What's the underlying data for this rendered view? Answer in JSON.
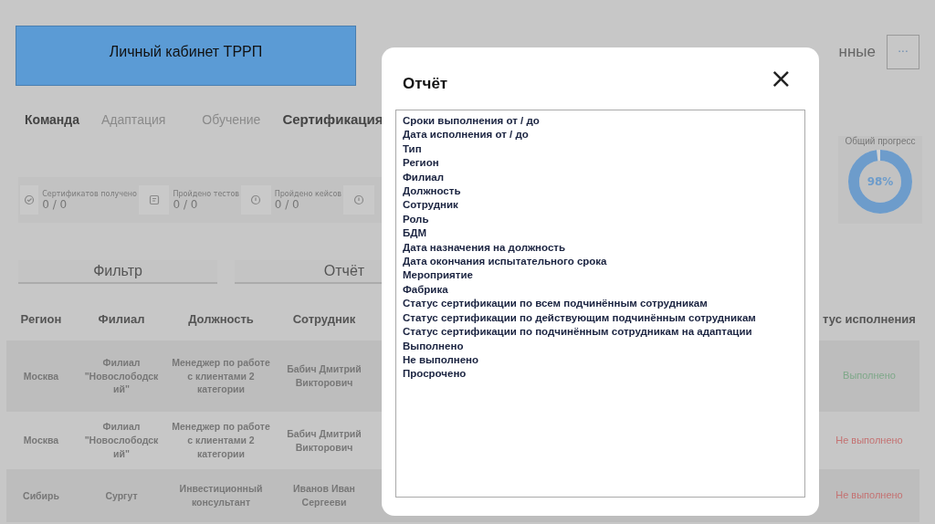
{
  "header": {
    "title": "Личный кабинет ТРРП",
    "right_text": "нные",
    "more_button": "···"
  },
  "tabs": [
    {
      "label": "Команда",
      "selected": true
    },
    {
      "label": "Адаптация",
      "selected": false
    },
    {
      "label": "Обучение",
      "selected": false
    },
    {
      "label": "Сертификация",
      "selected": true
    }
  ],
  "stats": [
    {
      "label": "Сертификатов получено",
      "value": "0 / 0",
      "kind": "check"
    },
    {
      "label": "Пройдено тестов",
      "value": "0 / 0",
      "kind": "doc"
    },
    {
      "label": "Пройдено кейсов",
      "value": "0 / 0",
      "kind": "info"
    },
    {
      "kind": "info"
    }
  ],
  "progress": {
    "label": "Общий прогресс",
    "level": 0.98,
    "reading": "98%"
  },
  "buttons": [
    "Фильтр",
    "Отчёт"
  ],
  "table": {
    "columns": [
      "Регион",
      "Филиал",
      "Должность",
      "Сотрудник"
    ],
    "status_column": "тус исполнения",
    "rows": [
      {
        "cells": [
          "Москва",
          "Филиал \"Новослободск ий\"",
          "Менеджер по работе с клиентами 2 категории",
          "Бабич Дмитрий Викторович"
        ],
        "status": "Выполнено",
        "kind": "done"
      },
      {
        "cells": [
          "Москва",
          "Филиал \"Новослободск ий\"",
          "Менеджер по работе с клиентами 2 категории",
          "Бабич Дмитрий Викторович"
        ],
        "status": "Не выполнено",
        "kind": "not_done"
      },
      {
        "cells": [
          "Сибирь",
          "Сургут",
          "Инвестиционный консультант",
          "Иванов Иван Сергееви"
        ],
        "status": "Не выполнено",
        "kind": "not_done"
      }
    ]
  },
  "modal": {
    "title": "Отчёт",
    "close": "×",
    "items": [
      "Сроки выполнения от / до",
      "Дата исполнения от / до",
      "Тип",
      "Регион",
      "Филиал",
      "Должность",
      "Сотрудник",
      "Роль",
      "БДМ",
      "Дата назначения на должность",
      "Дата окончания испытательного срока",
      "Мероприятие",
      "Фабрика",
      "Статус сертификации по всем подчинённым сотрудникам",
      "Статус сертификации по действующим подчинённым сотрудникам",
      "Статус сертификации по подчинённым сотрудникам на адаптации",
      "Выполнено",
      "Не выполнено",
      "Просрочено"
    ]
  }
}
